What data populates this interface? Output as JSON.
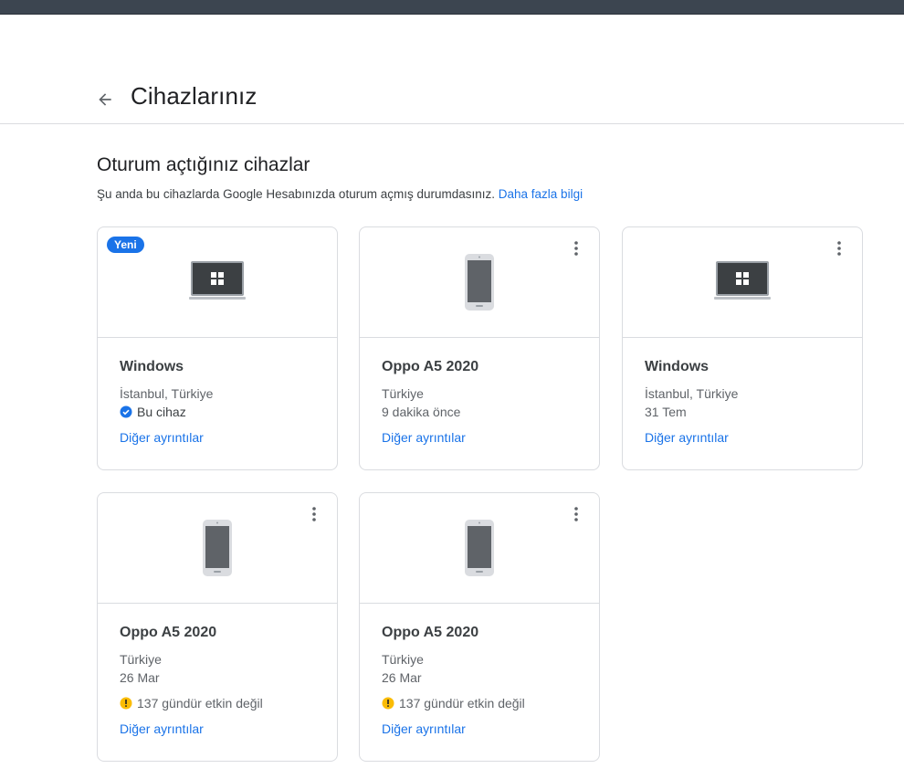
{
  "header": {
    "title": "Cihazlarınız"
  },
  "section": {
    "title": "Oturum açtığınız cihazlar",
    "description": "Şu anda bu cihazlarda Google Hesabınızda oturum açmış durumdasınız.",
    "learn_more": "Daha fazla bilgi"
  },
  "cards": [
    {
      "badge": "Yeni",
      "type": "laptop-icon",
      "name": "Windows",
      "location": "İstanbul, Türkiye",
      "status": "Bu cihaz",
      "link": "Diğer ayrıntılar"
    },
    {
      "type": "phone-icon",
      "name": "Oppo A5 2020",
      "location": "Türkiye",
      "time": "9 dakika önce",
      "link": "Diğer ayrıntılar"
    },
    {
      "type": "laptop-icon",
      "name": "Windows",
      "location": "İstanbul, Türkiye",
      "time": "31 Tem",
      "link": "Diğer ayrıntılar"
    },
    {
      "type": "phone-icon",
      "name": "Oppo A5 2020",
      "location": "Türkiye",
      "time": "26 Mar",
      "warning": "137 gündür etkin değil",
      "link": "Diğer ayrıntılar"
    },
    {
      "type": "phone-icon",
      "name": "Oppo A5 2020",
      "location": "Türkiye",
      "time": "26 Mar",
      "warning": "137 gündür etkin değil",
      "link": "Diğer ayrıntılar"
    }
  ],
  "colors": {
    "accent": "#1a73e8",
    "warning": "#fbbc04",
    "text": "#202124",
    "muted": "#5f6368",
    "border": "#dadce0"
  }
}
